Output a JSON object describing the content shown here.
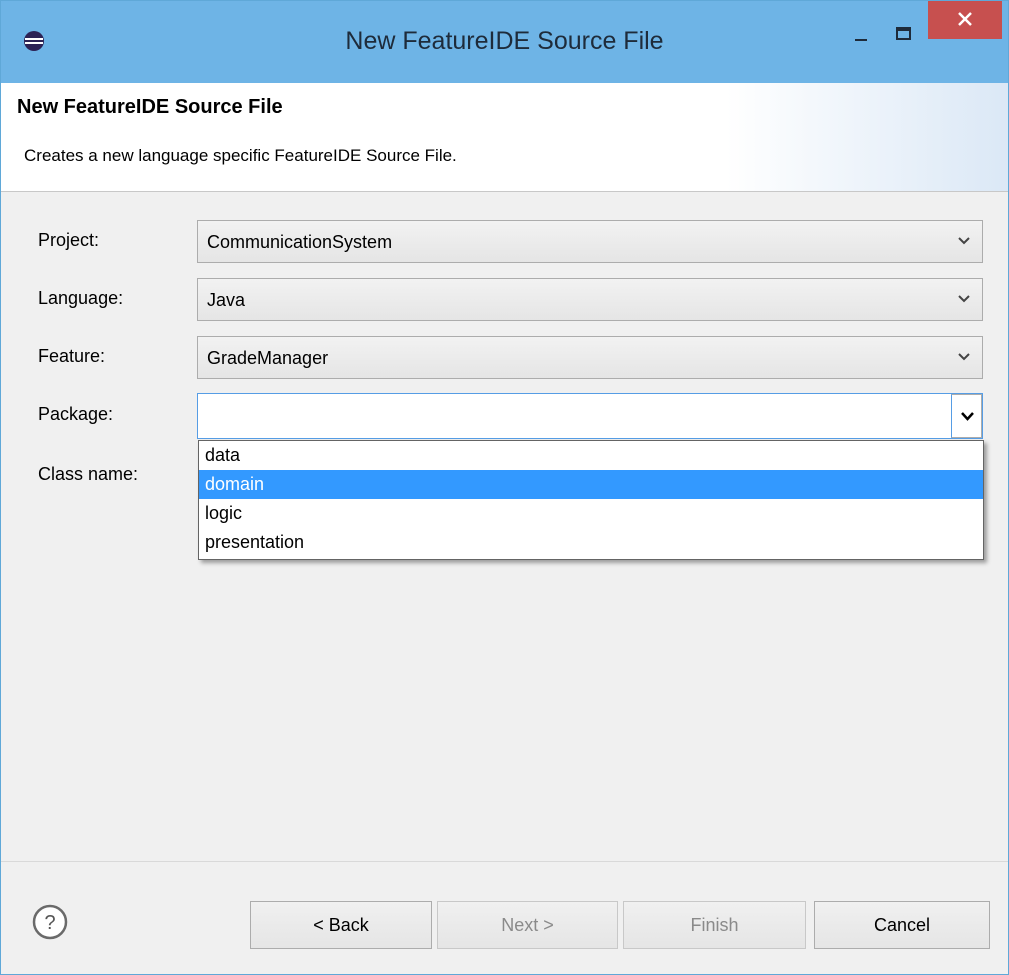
{
  "window": {
    "title": "New FeatureIDE Source File",
    "icons": {
      "app": "eclipse-icon",
      "minimize": "minimize-icon",
      "maximize": "maximize-icon",
      "close": "close-icon"
    }
  },
  "header": {
    "title": "New FeatureIDE Source File",
    "description": "Creates a new language specific FeatureIDE Source File."
  },
  "form": {
    "project": {
      "label": "Project:",
      "value": "CommunicationSystem"
    },
    "language": {
      "label": "Language:",
      "value": "Java"
    },
    "feature": {
      "label": "Feature:",
      "value": "GradeManager"
    },
    "package": {
      "label": "Package:",
      "value": ""
    },
    "class_name": {
      "label": "Class name:"
    }
  },
  "package_dropdown": {
    "options": [
      "data",
      "domain",
      "logic",
      "presentation"
    ],
    "highlighted": "domain"
  },
  "footer": {
    "help_icon": "help-icon",
    "back_label": "< Back",
    "next_label": "Next >",
    "finish_label": "Finish",
    "cancel_label": "Cancel"
  },
  "colors": {
    "titlebar": "#6eb4e6",
    "close_button": "#c7504f",
    "selection": "#3399ff"
  }
}
